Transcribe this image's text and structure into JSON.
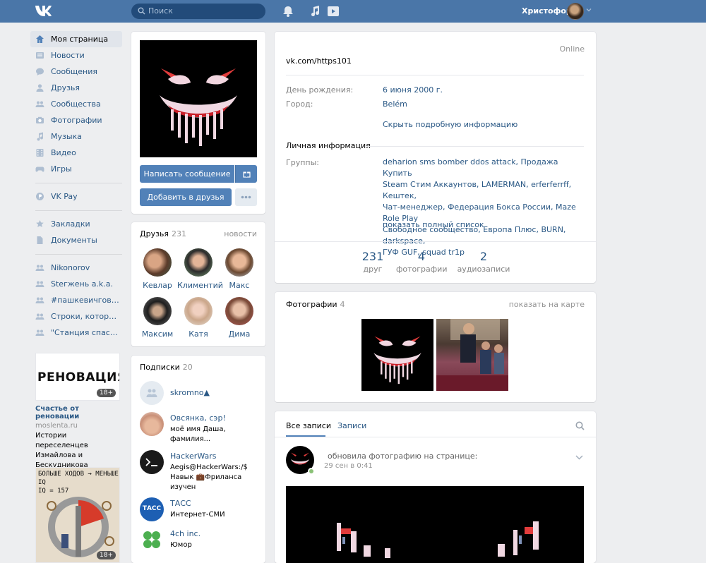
{
  "header": {
    "search_placeholder": "Поиск",
    "user_name": "Христофор"
  },
  "nav": {
    "items": [
      {
        "label": "Моя страница",
        "icon": "home-icon"
      },
      {
        "label": "Новости",
        "icon": "news-icon"
      },
      {
        "label": "Сообщения",
        "icon": "messages-icon"
      },
      {
        "label": "Друзья",
        "icon": "friends-icon"
      },
      {
        "label": "Сообщества",
        "icon": "groups-icon"
      },
      {
        "label": "Фотографии",
        "icon": "photos-icon"
      },
      {
        "label": "Музыка",
        "icon": "music-icon"
      },
      {
        "label": "Видео",
        "icon": "video-icon"
      },
      {
        "label": "Игры",
        "icon": "games-icon"
      }
    ],
    "vkpay": "VK Pay",
    "items2": [
      {
        "label": "Закладки",
        "icon": "bookmark-icon"
      },
      {
        "label": "Документы",
        "icon": "documents-icon"
      }
    ],
    "groups": [
      "Nikonorov",
      "Stегжень a.k.a.",
      "#пашкевичговорит",
      "Строки, которые..",
      "\"Станция спасен.."
    ]
  },
  "ads": [
    {
      "image_text": "РЕНОВАЦИЯ",
      "badge": "18+",
      "title": "Счастье от реновации",
      "domain": "moslenta.ru",
      "text": "Истории переселенцев Измайлова и Бескудникова"
    },
    {
      "image_text_line1": "БОЛЬШЕ ХОДОВ → МЕНЬШЕ IQ",
      "image_text_line2": "IQ = 157",
      "badge": "18+"
    }
  ],
  "profile": {
    "message_button": "Написать сообщение",
    "add_friend_button": "Добавить в друзья",
    "online": "Online",
    "status": "vk.com/https101",
    "birthday_label": "День рождения:",
    "birthday_value": "6 июня 2000 г.",
    "city_label": "Город:",
    "city_value": "Belém",
    "hide_details": "Скрыть подробную информацию",
    "personal_title": "Личная информация",
    "groups_label": "Группы:",
    "groups_lines": [
      "deharion sms bomber ddos attack, Продажа Купить",
      "Steam Стим Аккаунтов, LAMERMAN, erferferrff, Кештек,",
      "Чат-менеджер, Федерация Бокса России, Maze Role Play",
      "Свободное сообщество, Европа Плюс, BURN, darkspace,",
      "ГУФ GUF, squad tr1p"
    ],
    "show_full_list": "показать полный список",
    "counters": [
      {
        "value": "231",
        "label": "друг"
      },
      {
        "value": "4",
        "label": "фотографии"
      },
      {
        "value": "2",
        "label": "аудиозаписи"
      }
    ]
  },
  "friends": {
    "title": "Друзья",
    "count": "231",
    "link": "новости",
    "list": [
      "Кевлар",
      "Климентий",
      "Макс",
      "Максим",
      "Катя",
      "Дима"
    ]
  },
  "subscriptions": {
    "title": "Подписки",
    "count": "20",
    "list": [
      {
        "name": "skromno▲",
        "desc": ""
      },
      {
        "name": "Овсянка, сэр!",
        "desc": "моё имя Даша, фамилия..."
      },
      {
        "name": "HackerWars",
        "desc": "Aegis@HackerWars:/$ Навык 💼Фриланса изучен"
      },
      {
        "name": "ТАСС",
        "desc": "Интернет-СМИ",
        "logo": "ТАСС"
      },
      {
        "name": "4ch inc.",
        "desc": "Юмор"
      }
    ]
  },
  "photos": {
    "title": "Фотографии",
    "count": "4",
    "link": "показать на карте"
  },
  "wall": {
    "tab_all": "Все записи",
    "tab_own": "Записи",
    "post_action": "обновила фотографию на странице:",
    "post_date": "29 сен в 0:41"
  },
  "colors": {
    "header": "#4a76a8",
    "accent": "#5181b8",
    "link": "#2a5885",
    "background": "#edeef0"
  }
}
